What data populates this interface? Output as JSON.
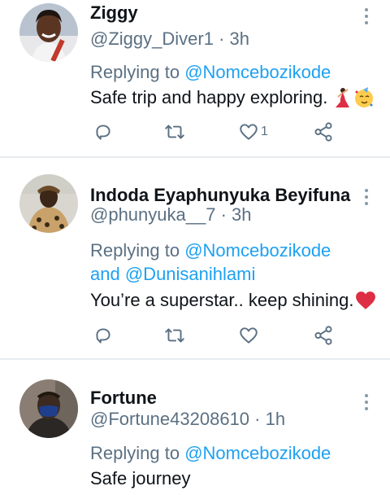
{
  "tweets": [
    {
      "name": "Ziggy",
      "handle": "@Ziggy_Diver1",
      "time": "3h",
      "replying_prefix": "Replying to",
      "mention1": "@Nomcebozikode",
      "text": "Safe trip and happy exploring.",
      "emojis": [
        "dancer-emoji",
        "party-face-emoji"
      ],
      "like_count": "1"
    },
    {
      "name": "Indoda Eyaphunyuka Beyifuna",
      "handle": "@phunyuka__7",
      "time": "3h",
      "replying_prefix": "Replying to",
      "mention1": "@Nomcebozikode",
      "conjunction": "and",
      "mention2": "@Dunisanihlami",
      "text": "You’re a superstar.. keep shining.",
      "emojis": [
        "red-heart-emoji"
      ]
    },
    {
      "name": "Fortune",
      "handle": "@Fortune43208610",
      "time": "1h",
      "replying_prefix": "Replying to",
      "mention1": "@Nomcebozikode",
      "text": "Safe journey"
    }
  ],
  "separator": "·",
  "colors": {
    "link": "#1da1f2",
    "secondary": "#5b7083",
    "divider": "#e6ecf0",
    "heart": "#e0245e"
  }
}
